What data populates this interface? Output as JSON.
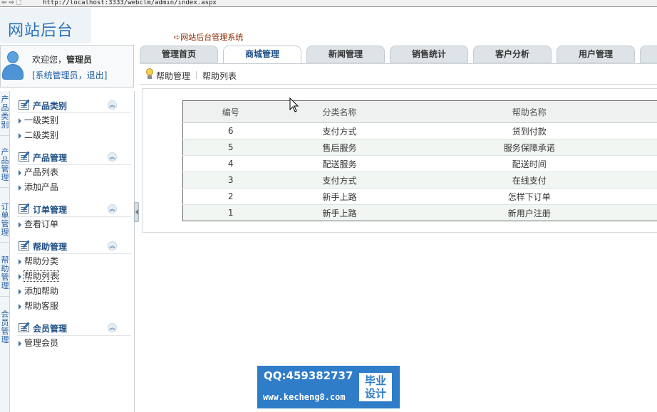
{
  "browser": {
    "nav": "⇦ ⇨ 🗋",
    "url": "http://localhost:3333/webclm/admin/index.aspx"
  },
  "header": {
    "logo": "网站后台",
    "system_name": "➪网站后台管理系统"
  },
  "user": {
    "welcome": "欢迎您，",
    "name": "管理员",
    "role_link": "[系统管理员",
    "separator": "，",
    "logout_link": "退出]"
  },
  "tabs": [
    {
      "label": "管理首页"
    },
    {
      "label": "商城管理"
    },
    {
      "label": "新闻管理"
    },
    {
      "label": "销售统计"
    },
    {
      "label": "客户分析"
    },
    {
      "label": "用户管理"
    }
  ],
  "subnav": {
    "item1": "帮助管理",
    "item2": "帮助列表"
  },
  "vertical_tabs": [
    "产品类别",
    "产品管理",
    "订单管理",
    "帮助管理",
    "会员管理"
  ],
  "sidebar": {
    "sections": [
      {
        "title": "产品类别",
        "items": [
          "一级类别",
          "二级类别"
        ]
      },
      {
        "title": "产品管理",
        "items": [
          "产品列表",
          "添加产品"
        ]
      },
      {
        "title": "订单管理",
        "items": [
          "查看订单"
        ]
      },
      {
        "title": "帮助管理",
        "items": [
          "帮助分类",
          "帮助列表",
          "添加帮助",
          "帮助客服"
        ]
      },
      {
        "title": "会员管理",
        "items": [
          "管理会员"
        ]
      }
    ],
    "collapse_glyph": "︽"
  },
  "table": {
    "columns": [
      "编号",
      "分类名称",
      "帮助名称"
    ],
    "rows": [
      [
        "6",
        "支付方式",
        "货到付款"
      ],
      [
        "5",
        "售后服务",
        "服务保障承诺"
      ],
      [
        "4",
        "配送服务",
        "配送时间"
      ],
      [
        "3",
        "支付方式",
        "在线支付"
      ],
      [
        "2",
        "新手上路",
        "怎样下订单"
      ],
      [
        "1",
        "新手上路",
        "新用户注册"
      ]
    ]
  },
  "watermark": {
    "qq": "QQ:459382737",
    "url": "www.kecheng8.com",
    "badge_line1": "毕业",
    "badge_line2": "设计"
  },
  "colors": {
    "accent": "#1f4f86",
    "link": "#1f5fa6",
    "watermark_bg": "#2f7cc9"
  }
}
